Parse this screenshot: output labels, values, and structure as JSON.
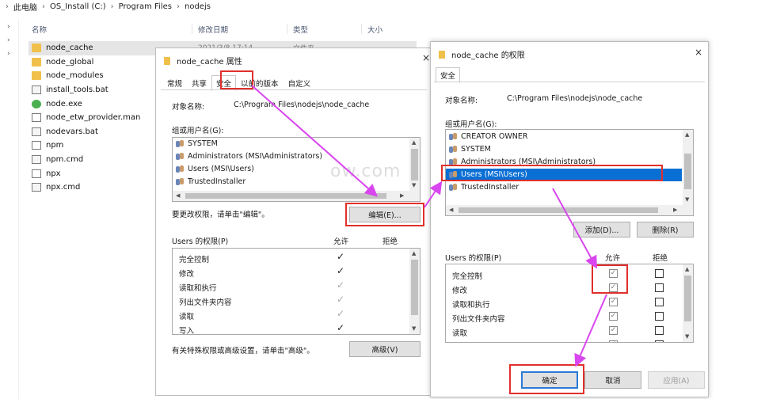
{
  "breadcrumb": [
    "此电脑",
    "OS_Install (C:)",
    "Program Files",
    "nodejs"
  ],
  "explorer": {
    "columns": {
      "name": "名称",
      "date": "修改日期",
      "type": "类型",
      "size": "大小"
    },
    "files": [
      {
        "name": "node_cache",
        "icon": "folder-icon",
        "date": "2021/3/8 17:14",
        "type": "文件夹"
      },
      {
        "name": "node_global",
        "icon": "folder-icon"
      },
      {
        "name": "node_modules",
        "icon": "folder-icon"
      },
      {
        "name": "install_tools.bat",
        "icon": "bat-file-icon"
      },
      {
        "name": "node.exe",
        "icon": "node-exe-icon"
      },
      {
        "name": "node_etw_provider.man",
        "icon": "file-icon"
      },
      {
        "name": "nodevars.bat",
        "icon": "bat-file-icon"
      },
      {
        "name": "npm",
        "icon": "file-icon"
      },
      {
        "name": "npm.cmd",
        "icon": "bat-file-icon"
      },
      {
        "name": "npx",
        "icon": "file-icon"
      },
      {
        "name": "npx.cmd",
        "icon": "bat-file-icon"
      }
    ]
  },
  "props_dialog": {
    "title": "node_cache 属性",
    "close": "×",
    "tabs": [
      "常规",
      "共享",
      "安全",
      "以前的版本",
      "自定义"
    ],
    "object_name_label": "对象名称:",
    "object_name_value": "C:\\Program Files\\nodejs\\node_cache",
    "group_label": "组或用户名(G):",
    "groups": [
      "SYSTEM",
      "Administrators (MSI\\Administrators)",
      "Users (MSI\\Users)",
      "TrustedInstaller"
    ],
    "edit_hint": "要更改权限，请单击\"编辑\"。",
    "edit_button": "编辑(E)...",
    "perm_header": "Users 的权限(P)",
    "allow": "允许",
    "deny": "拒绝",
    "permissions": [
      "完全控制",
      "修改",
      "读取和执行",
      "列出文件夹内容",
      "读取",
      "写入"
    ],
    "advanced_hint": "有关特殊权限或高级设置，请单击\"高级\"。",
    "advanced_button": "高级(V)"
  },
  "perm_dialog": {
    "title": "node_cache 的权限",
    "close": "×",
    "tab": "安全",
    "object_name_label": "对象名称:",
    "object_name_value": "C:\\Program Files\\nodejs\\node_cache",
    "group_label": "组或用户名(G):",
    "groups": [
      "CREATOR OWNER",
      "SYSTEM",
      "Administrators (MSI\\Administrators)",
      "Users (MSI\\Users)",
      "TrustedInstaller"
    ],
    "add_button": "添加(D)...",
    "remove_button": "删除(R)",
    "perm_header": "Users 的权限(P)",
    "allow": "允许",
    "deny": "拒绝",
    "permissions": [
      "完全控制",
      "修改",
      "读取和执行",
      "列出文件夹内容",
      "读取"
    ],
    "ok_button": "确定",
    "cancel_button": "取消",
    "apply_button": "应用(A)"
  },
  "watermark": "ow.com",
  "colors": {
    "annotation": "#e0302c",
    "arrow": "#d946ef",
    "selection": "#0a6fd4"
  }
}
